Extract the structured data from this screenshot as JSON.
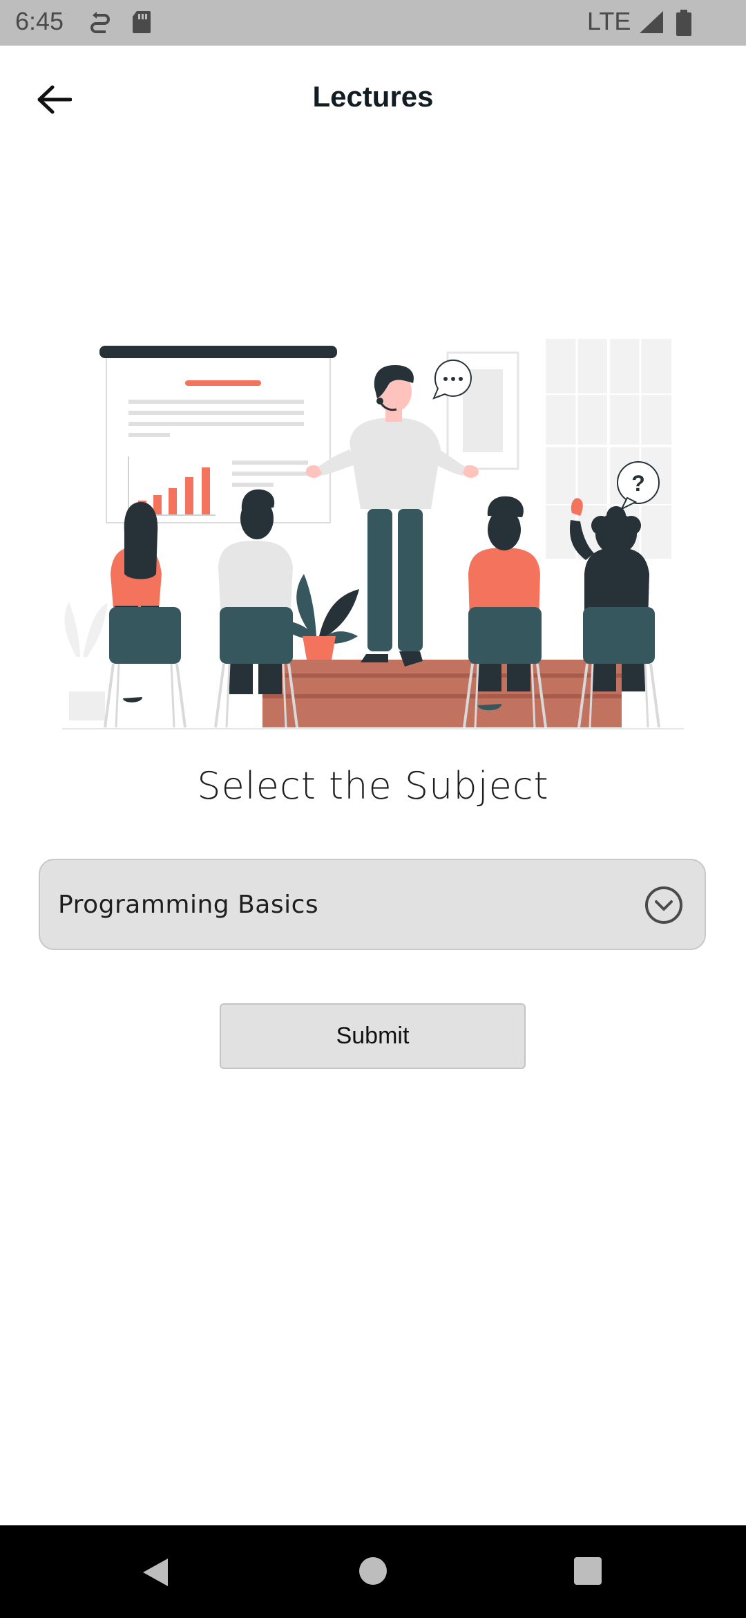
{
  "status_bar": {
    "time": "6:45",
    "network": "LTE",
    "icons": [
      "sync-icon",
      "sd-card-icon",
      "signal-icon",
      "battery-icon"
    ]
  },
  "app_bar": {
    "title": "Lectures",
    "back_icon": "arrow-left-icon"
  },
  "main": {
    "heading": "Select the Subject",
    "dropdown": {
      "selected": "Programming Basics",
      "icon": "chevron-down-circle-icon"
    },
    "submit_label": "Submit"
  },
  "illustration": {
    "bubble_question": "?",
    "bubble_dots": "..."
  },
  "nav_bar": {
    "icons": [
      "back-triangle-icon",
      "home-circle-icon",
      "recents-square-icon"
    ]
  },
  "colors": {
    "accent": "#f4735c",
    "dark": "#263238",
    "slate": "#37575f",
    "stage": "#c27360"
  }
}
